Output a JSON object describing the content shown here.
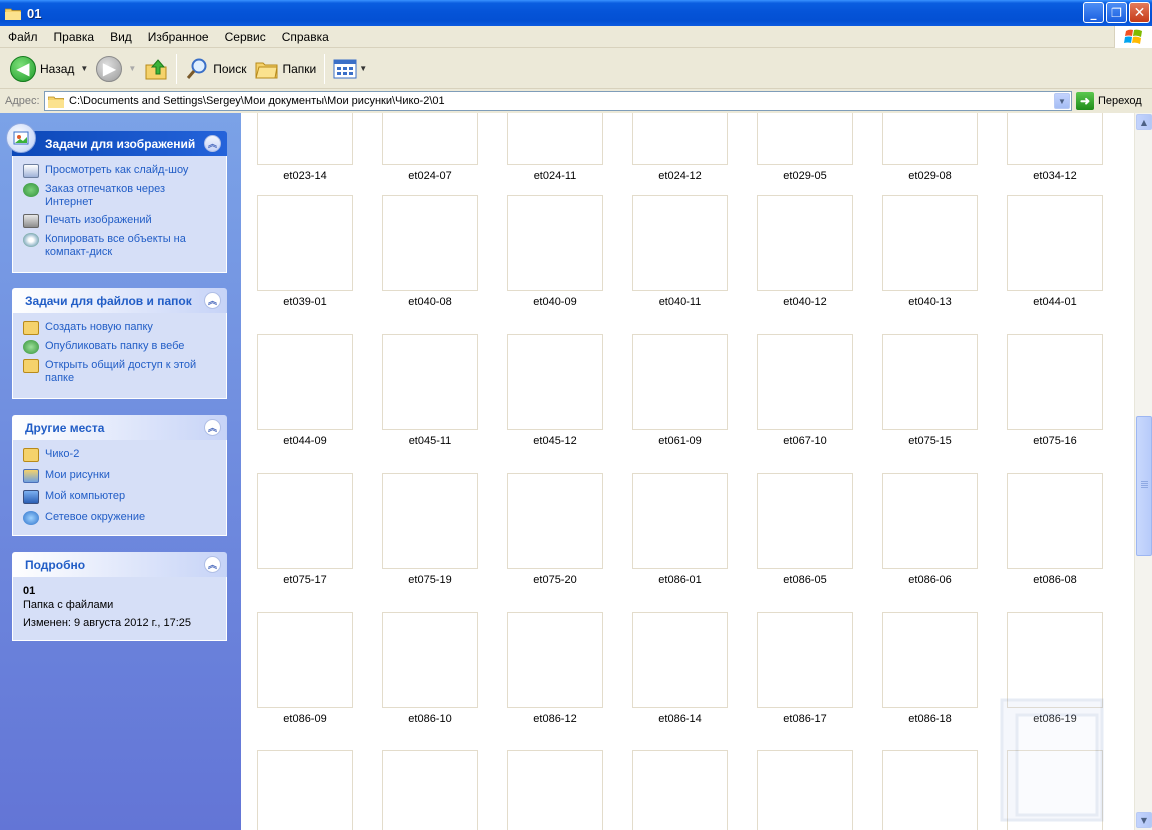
{
  "window": {
    "title": "01"
  },
  "menu": [
    "Файл",
    "Правка",
    "Вид",
    "Избранное",
    "Сервис",
    "Справка"
  ],
  "toolbar": {
    "back": "Назад",
    "search": "Поиск",
    "folders": "Папки"
  },
  "address": {
    "label": "Адрес:",
    "path": "C:\\Documents and Settings\\Sergey\\Мои документы\\Мои рисунки\\Чико-2\\01",
    "go": "Переход"
  },
  "panes": {
    "image_tasks": {
      "title": "Задачи для изображений",
      "items": [
        "Просмотреть как слайд-шоу",
        "Заказ отпечатков через Интернет",
        "Печать изображений",
        "Копировать все объекты на компакт-диск"
      ]
    },
    "file_tasks": {
      "title": "Задачи для файлов и папок",
      "items": [
        "Создать новую папку",
        "Опубликовать папку в вебе",
        "Открыть общий доступ к этой папке"
      ]
    },
    "other_places": {
      "title": "Другие места",
      "items": [
        "Чико-2",
        "Мои рисунки",
        "Мой компьютер",
        "Сетевое окружение"
      ]
    },
    "details": {
      "title": "Подробно",
      "name": "01",
      "type": "Папка с файлами",
      "modified": "Изменен: 9 августа 2012 г., 17:25"
    }
  },
  "files": [
    [
      "et023-14",
      "et024-07",
      "et024-11",
      "et024-12",
      "et029-05",
      "et029-08",
      "et034-12"
    ],
    [
      "et039-01",
      "et040-08",
      "et040-09",
      "et040-11",
      "et040-12",
      "et040-13",
      "et044-01"
    ],
    [
      "et044-09",
      "et045-11",
      "et045-12",
      "et061-09",
      "et067-10",
      "et075-15",
      "et075-16"
    ],
    [
      "et075-17",
      "et075-19",
      "et075-20",
      "et086-01",
      "et086-05",
      "et086-06",
      "et086-08"
    ],
    [
      "et086-09",
      "et086-10",
      "et086-12",
      "et086-14",
      "et086-17",
      "et086-18",
      "et086-19"
    ],
    [
      "",
      "",
      "",
      "",
      "",
      "",
      ""
    ]
  ],
  "colors": {
    "title_blue": "#0554d8",
    "task_link": "#215dc6",
    "pane_bg": "#d6dff7",
    "left_bg": "#7ba2e7"
  }
}
